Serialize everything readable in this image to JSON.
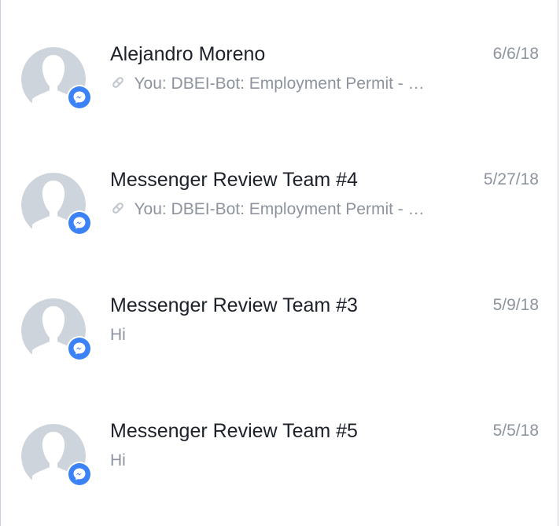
{
  "colors": {
    "name_text": "#1d2129",
    "secondary_text": "#8d949e",
    "avatar_silhouette": "#ced4dc",
    "messenger_blue": "#3b82f6",
    "border": "#c9d3e0"
  },
  "threads": [
    {
      "name": "Alejandro Moreno",
      "date": "6/6/18",
      "snippet": "You: DBEI-Bot: Employment Permit - …",
      "has_attachment_icon": true,
      "avatar_icon": "default-user-silhouette-icon",
      "badge_icon": "messenger-icon"
    },
    {
      "name": "Messenger Review Team #4",
      "date": "5/27/18",
      "snippet": "You: DBEI-Bot: Employment Permit - …",
      "has_attachment_icon": true,
      "avatar_icon": "default-user-silhouette-icon",
      "badge_icon": "messenger-icon"
    },
    {
      "name": "Messenger Review Team #3",
      "date": "5/9/18",
      "snippet": "Hi",
      "has_attachment_icon": false,
      "avatar_icon": "default-user-silhouette-icon",
      "badge_icon": "messenger-icon"
    },
    {
      "name": "Messenger Review Team #5",
      "date": "5/5/18",
      "snippet": "Hi",
      "has_attachment_icon": false,
      "avatar_icon": "default-user-silhouette-icon",
      "badge_icon": "messenger-icon"
    }
  ]
}
